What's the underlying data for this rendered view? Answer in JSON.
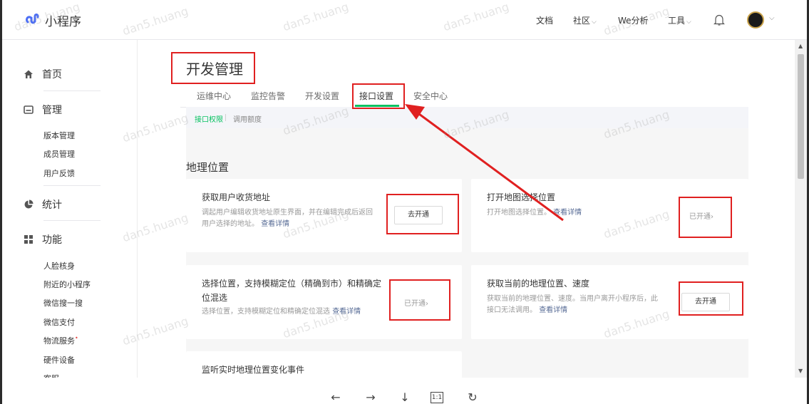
{
  "header": {
    "app_title": "小程序",
    "nav": [
      {
        "label": "文档",
        "has_dropdown": false
      },
      {
        "label": "社区",
        "has_dropdown": true
      },
      {
        "label": "We分析",
        "has_dropdown": false
      },
      {
        "label": "工具",
        "has_dropdown": true
      }
    ],
    "dropdown_glyph": "⌵",
    "icons": {
      "logo": "mini-program-logo",
      "bell": "notification-bell-icon",
      "avatar": "user-avatar"
    }
  },
  "sidebar": {
    "groups": [
      {
        "label": "首页",
        "icon": "home-icon",
        "items": []
      },
      {
        "label": "管理",
        "icon": "manage-icon",
        "items": [
          "版本管理",
          "成员管理",
          "用户反馈"
        ]
      },
      {
        "label": "统计",
        "icon": "pie-chart-icon",
        "items": []
      },
      {
        "label": "功能",
        "icon": "grid-icon",
        "items": [
          "人脸核身",
          "附近的小程序",
          "微信搜一搜",
          "微信支付",
          "物流服务",
          "硬件设备",
          "客服"
        ]
      }
    ],
    "badge_item": "物流服务",
    "badge_glyph": "•"
  },
  "main": {
    "page_title": "开发管理",
    "tabs": [
      "运维中心",
      "监控告警",
      "开发设置",
      "接口设置",
      "安全中心"
    ],
    "active_tab": "接口设置",
    "subtabs": [
      "接口权限",
      "调用额度"
    ],
    "active_subtab": "接口权限",
    "section_title": "地理位置",
    "cards": [
      {
        "title": "获取用户收货地址",
        "desc": "调起用户编辑收货地址原生界面，并在编辑完成后返回用户选择的地址。",
        "link": "查看详情",
        "action_type": "button",
        "action": "去开通"
      },
      {
        "title": "打开地图选择位置",
        "desc": "打开地图选择位置。",
        "link": "查看详情",
        "action_type": "status",
        "action": "已开通"
      },
      {
        "title": "选择位置，支持模糊定位（精确到市）和精确定位混选",
        "desc": "选择位置，支持模糊定位和精确定位混选",
        "link": "查看详情",
        "action_type": "status",
        "action": "已开通"
      },
      {
        "title": "获取当前的地理位置、速度",
        "desc": "获取当前的地理位置、速度。当用户离开小程序后，此接口无法调用。",
        "link": "查看详情",
        "action_type": "button",
        "action": "去开通"
      },
      {
        "title": "监听实时地理位置变化事件",
        "desc": "",
        "link": "",
        "action_type": "none",
        "action": ""
      }
    ],
    "chevron_glyph": "›"
  },
  "watermark": "dan5.huang",
  "viewer_toolbar": [
    {
      "name": "prev",
      "glyph": "←"
    },
    {
      "name": "next",
      "glyph": "→"
    },
    {
      "name": "download",
      "glyph": "↓"
    },
    {
      "name": "actual-size",
      "glyph": "1:1"
    },
    {
      "name": "rotate",
      "glyph": "↻"
    }
  ],
  "annotation_color": "#e02020",
  "accent_color": "#07c160",
  "link_color": "#576b95"
}
